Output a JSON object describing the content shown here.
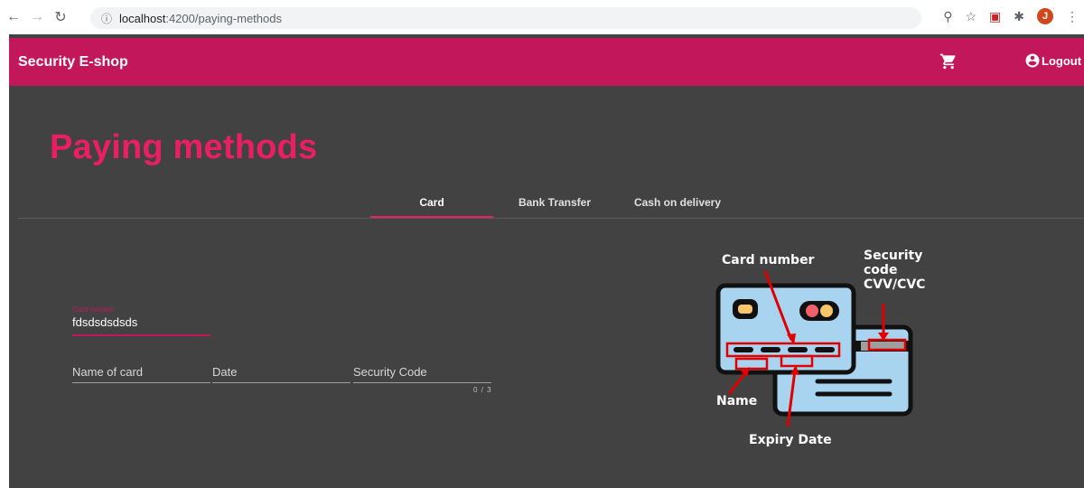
{
  "browser": {
    "url_host": "localhost",
    "url_path": ":4200/paying-methods",
    "profile_initial": "J"
  },
  "toolbar": {
    "brand": "Security E-shop",
    "cart_icon": "shopping-cart-icon",
    "logout_label": "Logout"
  },
  "page": {
    "title": "Paying methods"
  },
  "tabs": [
    {
      "label": "Card",
      "active": true
    },
    {
      "label": "Bank Transfer",
      "active": false
    },
    {
      "label": "Cash on delivery",
      "active": false
    }
  ],
  "form": {
    "card_number_label": "Card number",
    "card_number_value": "fdsdsdsdsds",
    "name_placeholder": "Name of card",
    "date_placeholder": "Date",
    "security_placeholder": "Security Code",
    "security_hint": "0 / 3"
  },
  "illustration": {
    "card_number": "Card number",
    "security_line1": "Security",
    "security_line2": "code",
    "security_line3": "CVV/CVC",
    "name": "Name",
    "expiry": "Expiry Date"
  },
  "colors": {
    "accent": "#c2185b",
    "title": "#e91e63",
    "background": "#424242"
  }
}
